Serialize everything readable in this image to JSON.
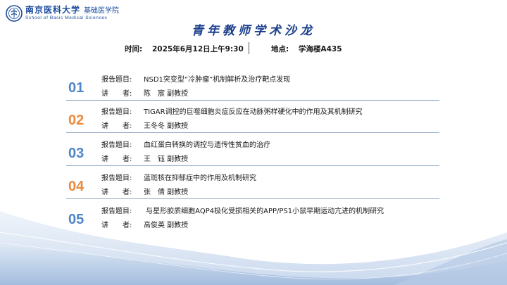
{
  "header": {
    "university": "南京医科大学",
    "school": "基础医学院",
    "school_en": "School of Basic Medical Sciences"
  },
  "title": "青年教师学术沙龙",
  "meta": {
    "time_label": "时间:",
    "time_value": "2025年6月12日上午9:30",
    "place_label": "地点:",
    "place_value": "学海楼A435"
  },
  "labels": {
    "topic": "报告题目:",
    "speaker": "讲　　者:"
  },
  "items": [
    {
      "num": "01",
      "topic": "NSD1突变型“冷肿瘤”机制解析及治疗靶点发现",
      "speaker": "陈　宸  副教授"
    },
    {
      "num": "02",
      "topic": "TIGAR调控的巨噬细胞炎症反应在动脉粥样硬化中的作用及其机制研究",
      "speaker": "王冬冬  副教授"
    },
    {
      "num": "03",
      "topic": "血红蛋白转换的调控与遗传性贫血的治疗",
      "speaker": "王　钰  副教授"
    },
    {
      "num": "04",
      "topic": "蓝斑核在抑郁症中的作用及机制研究",
      "speaker": "张　倩  副教授"
    },
    {
      "num": "05",
      "topic": " 与星形胶质细胞AQP4极化受损相关的APP/PS1小鼠早期运动亢进的机制研究",
      "speaker": "高俊英  副教授"
    }
  ],
  "colors": {
    "blue_number": "#4f86c9",
    "orange_number": "#ea8b3f",
    "title": "#1b3f8c"
  }
}
